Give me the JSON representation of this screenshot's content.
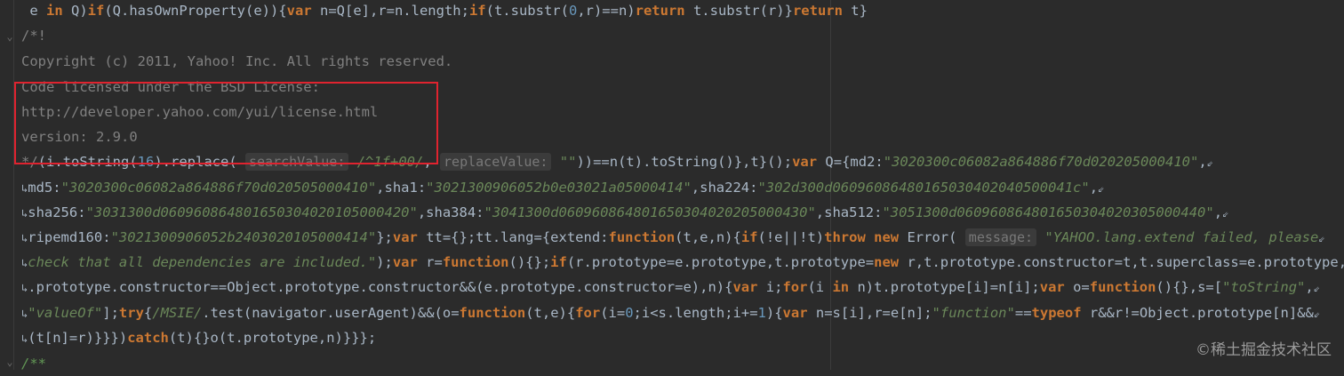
{
  "editor": {
    "lines": [
      " e in Q)if(Q.hasOwnProperty(e)){var n=Q[e],r=n.length;if(t.substr(0,r)==n)return t.substr(r)}return t}",
      "/*!",
      "Copyright (c) 2011, Yahoo! Inc. All rights reserved.",
      "Code licensed under the BSD License:",
      "http://developer.yahoo.com/yui/license.html",
      "version: 2.9.0",
      "*/(i.toString(16).replace( searchValue: /^1f+00/, replaceValue: \"\"))==n(t).toString()},t}();var Q={md2:\"3020300c06082a864886f70d020205000410\",",
      "md5:\"3020300c06082a864886f70d020505000410\",sha1:\"3021300906052b0e03021a05000414\",sha224:\"302d300d06096086480165030402040500041c\",",
      "sha256:\"3031300d060960864801650304020105000420\",sha384:\"3041300d060960864801650304020205000430\",sha512:\"3051300d060960864801650304020305000440\",",
      "ripemd160:\"3021300906052b2403020105000414\"};var tt={};tt.lang={extend:function(t,e,n){if(!e||!t)throw new Error( message: \"YAHOO.lang.extend failed, please",
      "check that all dependencies are included.\");var r=function(){};if(r.prototype=e.prototype,t.prototype=new r,t.prototype.constructor=t,t.superclass=e.prototype,e",
      ".prototype.constructor==Object.prototype.constructor&&(e.prototype.constructor=e),n){var i;for(i in n)t.prototype[i]=n[i];var o=function(){},s=[\"toString\",",
      "\"valueOf\"];try{/MSIE/.test(navigator.userAgent)&&(o=function(t,e){for(i=0;i<s.length;i+=1){var n=s[i],r=e[n];\"function\"==typeof r&&r!=Object.prototype[n]&&",
      "(t[n]=r)}}})catch(t){}o(t.prototype,n)}}};",
      "/**"
    ],
    "inlay_hints": [
      "searchValue:",
      "replaceValue:",
      "message:"
    ]
  },
  "watermark": "©稀土掘金技术社区",
  "colors": {
    "background": "#2b2b2b",
    "keyword": "#cc7832",
    "string": "#6a8759",
    "comment": "#808080",
    "highlight_box": "#e0232f"
  }
}
